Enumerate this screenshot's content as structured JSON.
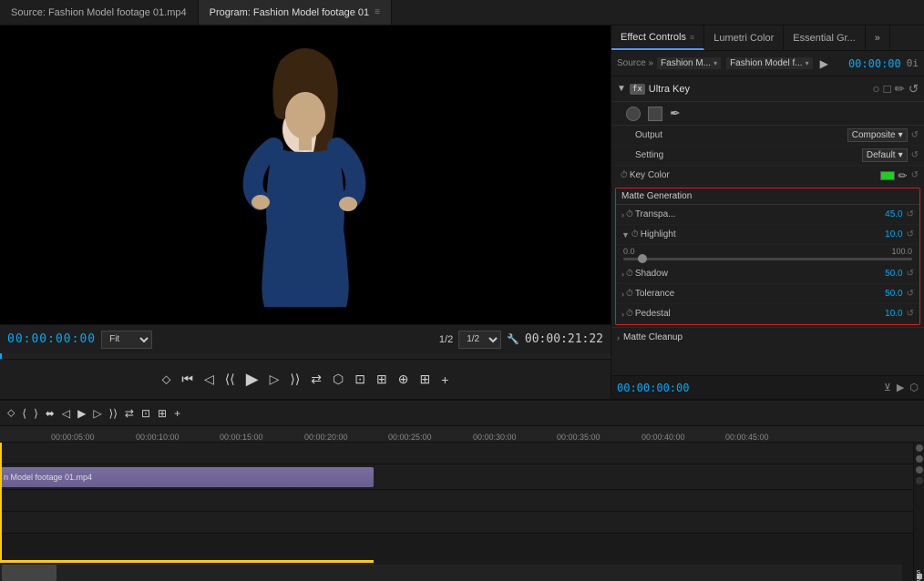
{
  "panels": {
    "source": {
      "label": "Source:",
      "title": "Source: Fashion Model footage 01.mp4"
    },
    "program": {
      "title": "Program: Fashion Model footage 01",
      "menu_icon": "≡"
    }
  },
  "effect_controls": {
    "tabs": [
      {
        "id": "effect-controls",
        "label": "Effect Controls",
        "active": true,
        "menu": "≡"
      },
      {
        "id": "lumetri-color",
        "label": "Lumetri Color",
        "active": false
      },
      {
        "id": "essential-gr",
        "label": "Essential Gr...",
        "active": false
      }
    ],
    "more_icon": "»",
    "source_row": {
      "label": "Source »",
      "source_value": "Fashion M...",
      "arrow": "▾",
      "clip_value": "Fashion Model f...",
      "clip_arrow": "▾",
      "play_icon": "▶",
      "timecode": "00:00:00"
    },
    "fx_section": {
      "collapse": "▼",
      "fx_badge": "fx",
      "title": "Ultra Key",
      "icons": [
        "○",
        "□",
        "✏"
      ]
    },
    "output": {
      "label": "Output",
      "value": "Composite",
      "arrow": "▾",
      "reset_icon": "↺"
    },
    "setting": {
      "label": "Setting",
      "value": "Default",
      "arrow": "▾",
      "reset_icon": "↺"
    },
    "key_color": {
      "label": "Key Color",
      "reset_icon": "↺"
    },
    "matte_generation": {
      "title": "Matte Generation",
      "transparency": {
        "label": "Transpa...",
        "value": "45.0",
        "expand": "›",
        "reset_icon": "↺"
      },
      "highlight": {
        "label": "Highlight",
        "value": "10.0",
        "expand": "▼",
        "reset_icon": "↺"
      },
      "slider": {
        "min": "0.0",
        "max": "100.0"
      },
      "shadow": {
        "label": "Shadow",
        "value": "50.0",
        "expand": "›",
        "reset_icon": "↺"
      },
      "tolerance": {
        "label": "Tolerance",
        "value": "50.0",
        "expand": "›",
        "reset_icon": "↺"
      },
      "pedestal": {
        "label": "Pedestal",
        "value": "10.0",
        "expand": "›",
        "reset_icon": "↺"
      }
    },
    "matte_cleanup": {
      "label": "Matte Cleanup",
      "expand": "›"
    },
    "bottom_bar": {
      "timecode": "00:00:00:00"
    }
  },
  "video_controls": {
    "timecode_left": "00:00:00:00",
    "fit_label": "Fit",
    "fit_arrow": "▾",
    "fraction": "1/2",
    "fraction_arrow": "▾",
    "timecode_right": "00:00:21:22"
  },
  "playback": {
    "buttons": [
      "⏮",
      "◀◀",
      "◀",
      "▶",
      "▶▶",
      "⏭",
      "⬌",
      "▥",
      "◉",
      "⊞",
      "+"
    ]
  },
  "timeline": {
    "ruler_marks": [
      "00:00:05:00",
      "00:00:10:00",
      "00:00:15:00",
      "00:00:20:00",
      "00:00:25:00",
      "00:00:30:00",
      "00:00:35:00",
      "00:00:40:00",
      "00:00:45:00"
    ],
    "clip_label": "n Model footage 01.mp4"
  }
}
